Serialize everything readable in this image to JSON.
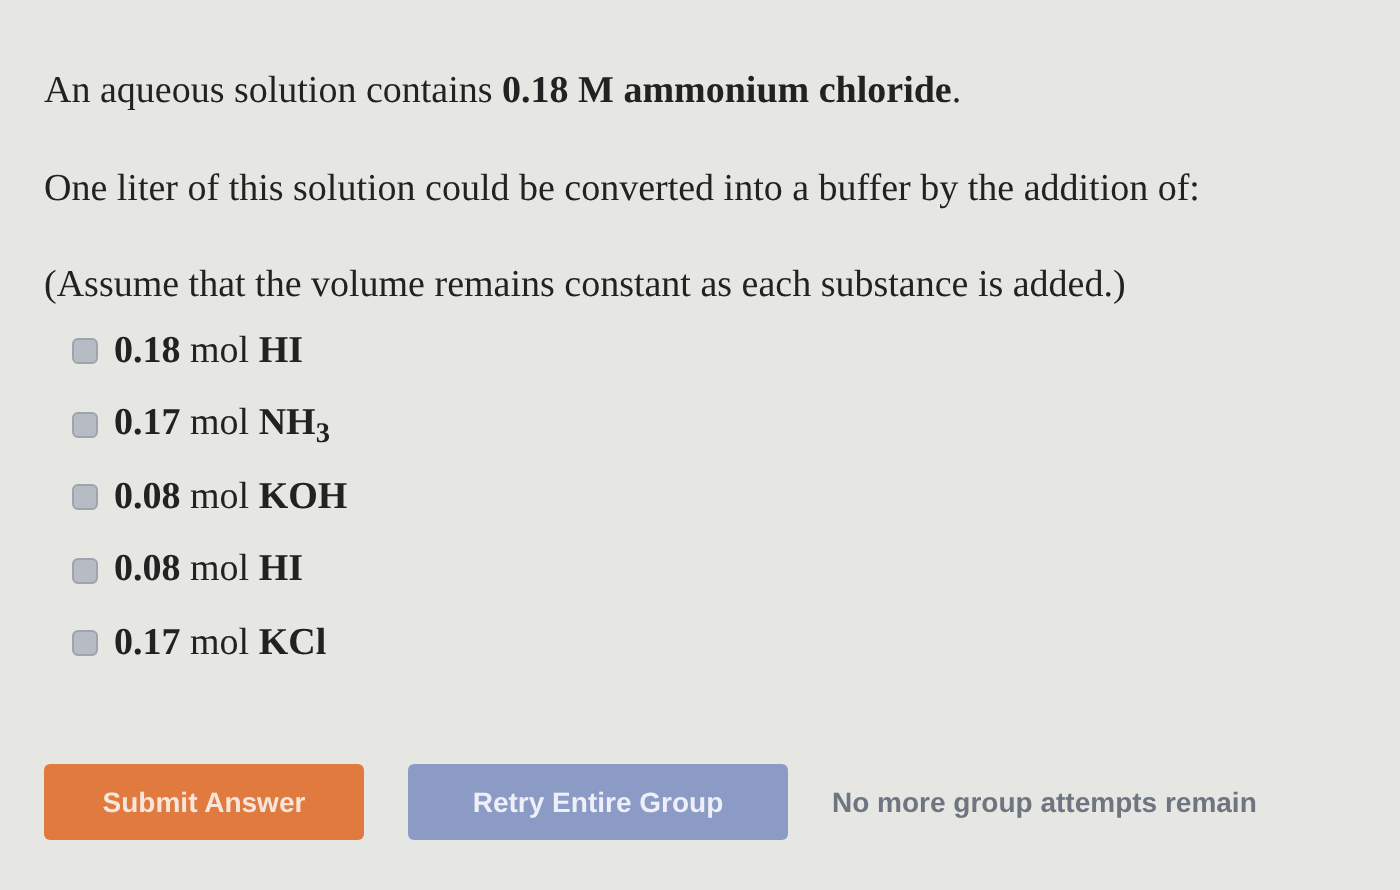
{
  "question": {
    "intro": "An aqueous solution contains **0.18 M ammonium chloride**.",
    "prompt": "One liter of this solution could be converted into a buffer by the addition of:",
    "note": "(Assume that the volume remains constant as each substance is added.)"
  },
  "options": [
    {
      "label": "**0.18** mol **HI**",
      "checked": false
    },
    {
      "label": "**0.17** mol **NH$_{3}$**",
      "checked": false
    },
    {
      "label": "**0.08** mol **KOH**",
      "checked": false
    },
    {
      "label": "**0.08** mol **HI**",
      "checked": false
    },
    {
      "label": "**0.17** mol **KCl**",
      "checked": false
    }
  ],
  "buttons": [
    {
      "label": "Submit Answer",
      "kind": "submit"
    },
    {
      "label": "Retry Entire Group",
      "kind": "retry"
    }
  ],
  "status": "No more group attempts remain"
}
